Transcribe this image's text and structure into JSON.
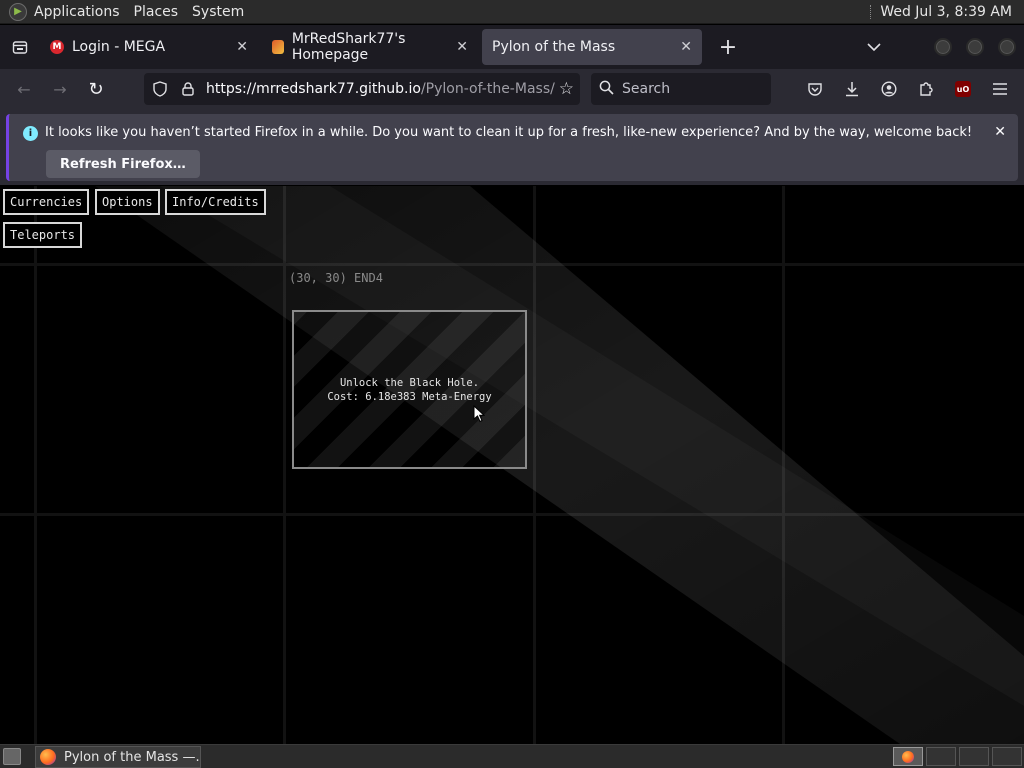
{
  "top_panel": {
    "menus": [
      "Applications",
      "Places",
      "System"
    ],
    "clock": "Wed Jul  3,  8:39 AM"
  },
  "tabs": [
    {
      "title": "Login - MEGA",
      "favicon": "mega-icon",
      "favicon_label": "M",
      "favicon_color": "#d9272e",
      "active": false
    },
    {
      "title": "MrRedShark77's Homepage",
      "favicon": "shark-icon",
      "favicon_label": "",
      "favicon_color": "#e05a2a",
      "active": false
    },
    {
      "title": "Pylon of the Mass",
      "favicon": "",
      "favicon_label": "",
      "favicon_color": "",
      "active": true
    }
  ],
  "navbar": {
    "url_host": "https://mrredshark77.github.io",
    "url_path": "/Pylon-of-the-Mass/",
    "search_placeholder": "Search"
  },
  "notification": {
    "message": "It looks like you haven’t started Firefox in a while. Do you want to clean it up for a fresh, like-new experience? And by the way, welcome back!",
    "button": "Refresh Firefox…"
  },
  "game": {
    "buttons": {
      "currencies": "Currencies",
      "options": "Options",
      "info": "Info/Credits",
      "teleports": "Teleports"
    },
    "coordinate": "(30, 30) END4",
    "node": {
      "line1": "Unlock the Black Hole.",
      "line2": "Cost: 6.18e383 Meta-Energy"
    }
  },
  "taskbar": {
    "window_title": "Pylon of the Mass —..."
  },
  "colors": {
    "accent": "#7542e5",
    "info": "#80ebff",
    "game_bg": "#000000"
  }
}
